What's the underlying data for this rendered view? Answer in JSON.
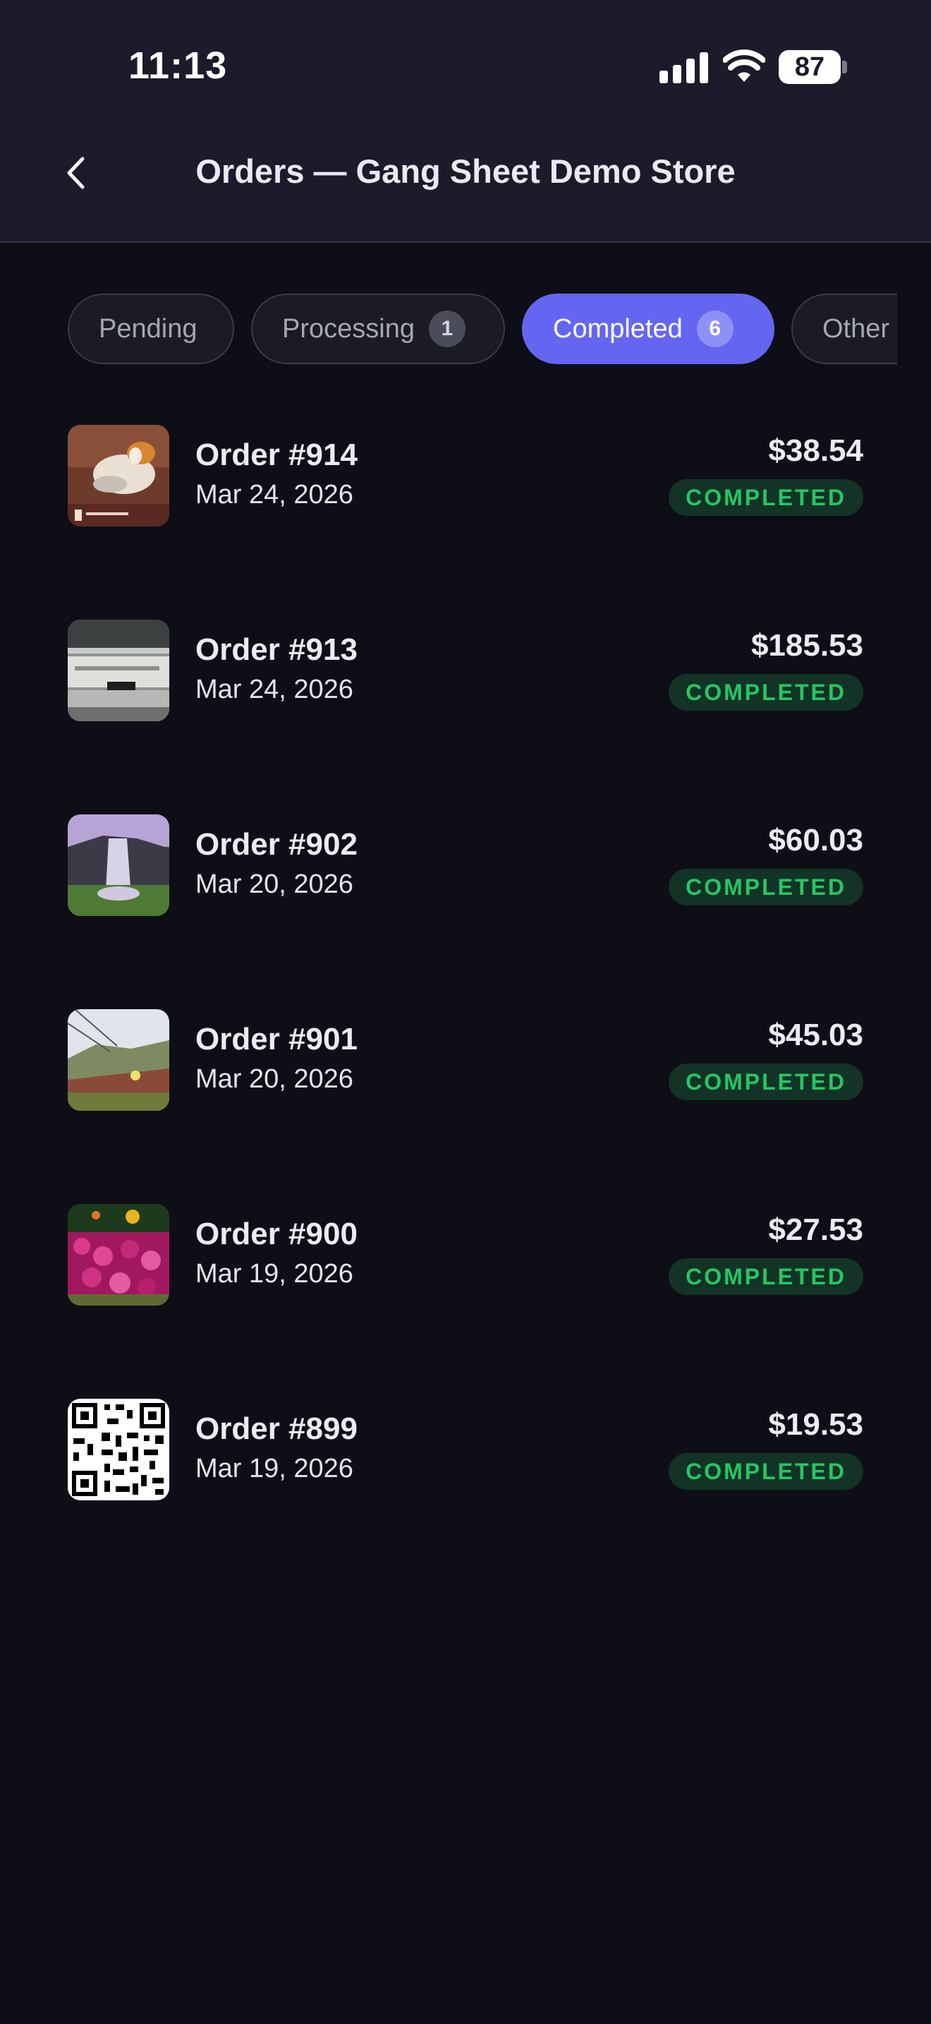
{
  "status_bar": {
    "time": "11:13",
    "battery": "87"
  },
  "header": {
    "title": "Orders — Gang Sheet Demo Store"
  },
  "tabs": [
    {
      "label": "Pending",
      "count": ""
    },
    {
      "label": "Processing",
      "count": "1"
    },
    {
      "label": "Completed",
      "count": "6",
      "active": true
    },
    {
      "label": "Other",
      "count": ""
    }
  ],
  "orders": [
    {
      "number": "Order #914",
      "date": "Mar 24, 2026",
      "price": "$38.54",
      "status": "COMPLETED",
      "thumbnail": "dog-photo"
    },
    {
      "number": "Order #913",
      "date": "Mar 24, 2026",
      "price": "$185.53",
      "status": "COMPLETED",
      "thumbnail": "machinery-photo"
    },
    {
      "number": "Order #902",
      "date": "Mar 20, 2026",
      "price": "$60.03",
      "status": "COMPLETED",
      "thumbnail": "waterfall-photo"
    },
    {
      "number": "Order #901",
      "date": "Mar 20, 2026",
      "price": "$45.03",
      "status": "COMPLETED",
      "thumbnail": "hillside-photo"
    },
    {
      "number": "Order #900",
      "date": "Mar 19, 2026",
      "price": "$27.53",
      "status": "COMPLETED",
      "thumbnail": "flowers-photo"
    },
    {
      "number": "Order #899",
      "date": "Mar 19, 2026",
      "price": "$19.53",
      "status": "COMPLETED",
      "thumbnail": "qr-code"
    }
  ],
  "colors": {
    "background": "#0e0e17",
    "header": "#1b1b2c",
    "accent": "#6466f1",
    "status_green": "#27c564"
  }
}
